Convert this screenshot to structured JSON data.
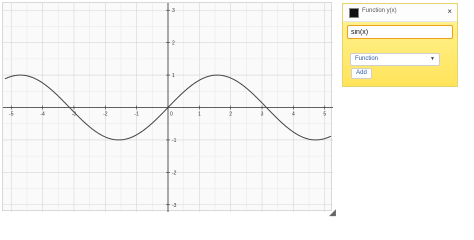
{
  "panel": {
    "title": "Function y(x)",
    "close_label": "×",
    "expression": "sin(x)",
    "type_selected": "Function",
    "add_label": "Add",
    "swatch_color": "#111111"
  },
  "graph": {
    "x_ticks": [
      "-5",
      "-4",
      "-3",
      "-2",
      "-1",
      "0",
      "1",
      "2",
      "3",
      "4",
      "5"
    ],
    "y_ticks": [
      "3",
      "2",
      "1",
      "-1",
      "-2",
      "-3"
    ],
    "x_range": [
      -5.2,
      5.2
    ],
    "y_range": [
      -3.1,
      3.1
    ],
    "function": "sin(x)",
    "curve_color": "#444444",
    "grid": true
  }
}
